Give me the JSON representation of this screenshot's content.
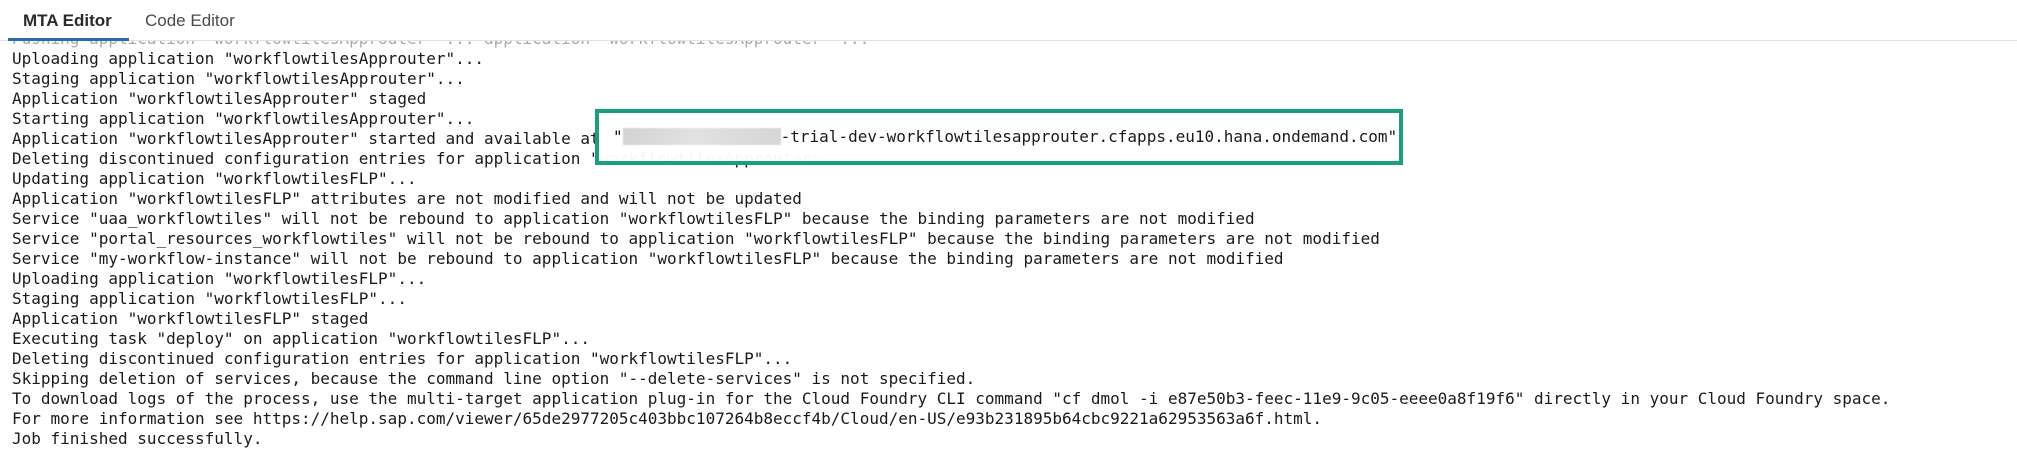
{
  "tabs": [
    {
      "label": "MTA Editor",
      "active": true
    },
    {
      "label": "Code Editor",
      "active": false
    }
  ],
  "console": {
    "clipped_top_line": "Pushing application \"workflowtilesApprouter\" ... application \"workflowtilesApprouter\" ...",
    "lines": [
      "Uploading application \"workflowtilesApprouter\"...",
      "Staging application \"workflowtilesApprouter\"...",
      "Application \"workflowtilesApprouter\" staged",
      "Starting application \"workflowtilesApprouter\"...",
      "Application \"workflowtilesApprouter\" started and available at \"",
      "Deleting discontinued configuration entries for application \"workflowtilesApprouter\"",
      "Updating application \"workflowtilesFLP\"...",
      "Application \"workflowtilesFLP\" attributes are not modified and will not be updated",
      "Service \"uaa_workflowtiles\" will not be rebound to application \"workflowtilesFLP\" because the binding parameters are not modified",
      "Service \"portal_resources_workflowtiles\" will not be rebound to application \"workflowtilesFLP\" because the binding parameters are not modified",
      "Service \"my-workflow-instance\" will not be rebound to application \"workflowtilesFLP\" because the binding parameters are not modified",
      "Uploading application \"workflowtilesFLP\"...",
      "Staging application \"workflowtilesFLP\"...",
      "Application \"workflowtilesFLP\" staged",
      "Executing task \"deploy\" on application \"workflowtilesFLP\"...",
      "Deleting discontinued configuration entries for application \"workflowtilesFLP\"...",
      "Skipping deletion of services, because the command line option \"--delete-services\" is not specified.",
      "To download logs of the process, use the multi-target application plug-in for the Cloud Foundry CLI command \"cf dmol -i e87e50b3-feec-11e9-9c05-eeee0a8f19f6\" directly in your Cloud Foundry space.",
      "For more information see https://help.sap.com/viewer/65de2977205c403bbc107264b8eccf4b/Cloud/en-US/e93b231895b64cbc9221a62953563a6f.html.",
      "Job finished successfully."
    ],
    "highlight": {
      "prefix": "\"",
      "url_suffix": "-trial-dev-workflowtilesapprouter.cfapps.eu10.hana.ondemand.com\"",
      "border_color": "#18a07f"
    }
  }
}
